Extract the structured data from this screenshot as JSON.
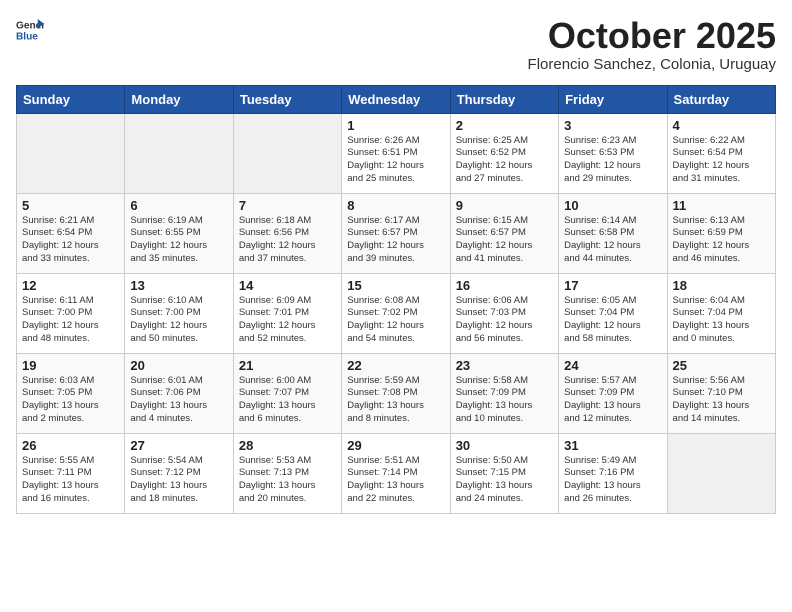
{
  "logo": {
    "text_general": "General",
    "text_blue": "Blue"
  },
  "header": {
    "month_title": "October 2025",
    "subtitle": "Florencio Sanchez, Colonia, Uruguay"
  },
  "weekdays": [
    "Sunday",
    "Monday",
    "Tuesday",
    "Wednesday",
    "Thursday",
    "Friday",
    "Saturday"
  ],
  "weeks": [
    [
      {
        "day": "",
        "info": ""
      },
      {
        "day": "",
        "info": ""
      },
      {
        "day": "",
        "info": ""
      },
      {
        "day": "1",
        "info": "Sunrise: 6:26 AM\nSunset: 6:51 PM\nDaylight: 12 hours\nand 25 minutes."
      },
      {
        "day": "2",
        "info": "Sunrise: 6:25 AM\nSunset: 6:52 PM\nDaylight: 12 hours\nand 27 minutes."
      },
      {
        "day": "3",
        "info": "Sunrise: 6:23 AM\nSunset: 6:53 PM\nDaylight: 12 hours\nand 29 minutes."
      },
      {
        "day": "4",
        "info": "Sunrise: 6:22 AM\nSunset: 6:54 PM\nDaylight: 12 hours\nand 31 minutes."
      }
    ],
    [
      {
        "day": "5",
        "info": "Sunrise: 6:21 AM\nSunset: 6:54 PM\nDaylight: 12 hours\nand 33 minutes."
      },
      {
        "day": "6",
        "info": "Sunrise: 6:19 AM\nSunset: 6:55 PM\nDaylight: 12 hours\nand 35 minutes."
      },
      {
        "day": "7",
        "info": "Sunrise: 6:18 AM\nSunset: 6:56 PM\nDaylight: 12 hours\nand 37 minutes."
      },
      {
        "day": "8",
        "info": "Sunrise: 6:17 AM\nSunset: 6:57 PM\nDaylight: 12 hours\nand 39 minutes."
      },
      {
        "day": "9",
        "info": "Sunrise: 6:15 AM\nSunset: 6:57 PM\nDaylight: 12 hours\nand 41 minutes."
      },
      {
        "day": "10",
        "info": "Sunrise: 6:14 AM\nSunset: 6:58 PM\nDaylight: 12 hours\nand 44 minutes."
      },
      {
        "day": "11",
        "info": "Sunrise: 6:13 AM\nSunset: 6:59 PM\nDaylight: 12 hours\nand 46 minutes."
      }
    ],
    [
      {
        "day": "12",
        "info": "Sunrise: 6:11 AM\nSunset: 7:00 PM\nDaylight: 12 hours\nand 48 minutes."
      },
      {
        "day": "13",
        "info": "Sunrise: 6:10 AM\nSunset: 7:00 PM\nDaylight: 12 hours\nand 50 minutes."
      },
      {
        "day": "14",
        "info": "Sunrise: 6:09 AM\nSunset: 7:01 PM\nDaylight: 12 hours\nand 52 minutes."
      },
      {
        "day": "15",
        "info": "Sunrise: 6:08 AM\nSunset: 7:02 PM\nDaylight: 12 hours\nand 54 minutes."
      },
      {
        "day": "16",
        "info": "Sunrise: 6:06 AM\nSunset: 7:03 PM\nDaylight: 12 hours\nand 56 minutes."
      },
      {
        "day": "17",
        "info": "Sunrise: 6:05 AM\nSunset: 7:04 PM\nDaylight: 12 hours\nand 58 minutes."
      },
      {
        "day": "18",
        "info": "Sunrise: 6:04 AM\nSunset: 7:04 PM\nDaylight: 13 hours\nand 0 minutes."
      }
    ],
    [
      {
        "day": "19",
        "info": "Sunrise: 6:03 AM\nSunset: 7:05 PM\nDaylight: 13 hours\nand 2 minutes."
      },
      {
        "day": "20",
        "info": "Sunrise: 6:01 AM\nSunset: 7:06 PM\nDaylight: 13 hours\nand 4 minutes."
      },
      {
        "day": "21",
        "info": "Sunrise: 6:00 AM\nSunset: 7:07 PM\nDaylight: 13 hours\nand 6 minutes."
      },
      {
        "day": "22",
        "info": "Sunrise: 5:59 AM\nSunset: 7:08 PM\nDaylight: 13 hours\nand 8 minutes."
      },
      {
        "day": "23",
        "info": "Sunrise: 5:58 AM\nSunset: 7:09 PM\nDaylight: 13 hours\nand 10 minutes."
      },
      {
        "day": "24",
        "info": "Sunrise: 5:57 AM\nSunset: 7:09 PM\nDaylight: 13 hours\nand 12 minutes."
      },
      {
        "day": "25",
        "info": "Sunrise: 5:56 AM\nSunset: 7:10 PM\nDaylight: 13 hours\nand 14 minutes."
      }
    ],
    [
      {
        "day": "26",
        "info": "Sunrise: 5:55 AM\nSunset: 7:11 PM\nDaylight: 13 hours\nand 16 minutes."
      },
      {
        "day": "27",
        "info": "Sunrise: 5:54 AM\nSunset: 7:12 PM\nDaylight: 13 hours\nand 18 minutes."
      },
      {
        "day": "28",
        "info": "Sunrise: 5:53 AM\nSunset: 7:13 PM\nDaylight: 13 hours\nand 20 minutes."
      },
      {
        "day": "29",
        "info": "Sunrise: 5:51 AM\nSunset: 7:14 PM\nDaylight: 13 hours\nand 22 minutes."
      },
      {
        "day": "30",
        "info": "Sunrise: 5:50 AM\nSunset: 7:15 PM\nDaylight: 13 hours\nand 24 minutes."
      },
      {
        "day": "31",
        "info": "Sunrise: 5:49 AM\nSunset: 7:16 PM\nDaylight: 13 hours\nand 26 minutes."
      },
      {
        "day": "",
        "info": ""
      }
    ]
  ]
}
